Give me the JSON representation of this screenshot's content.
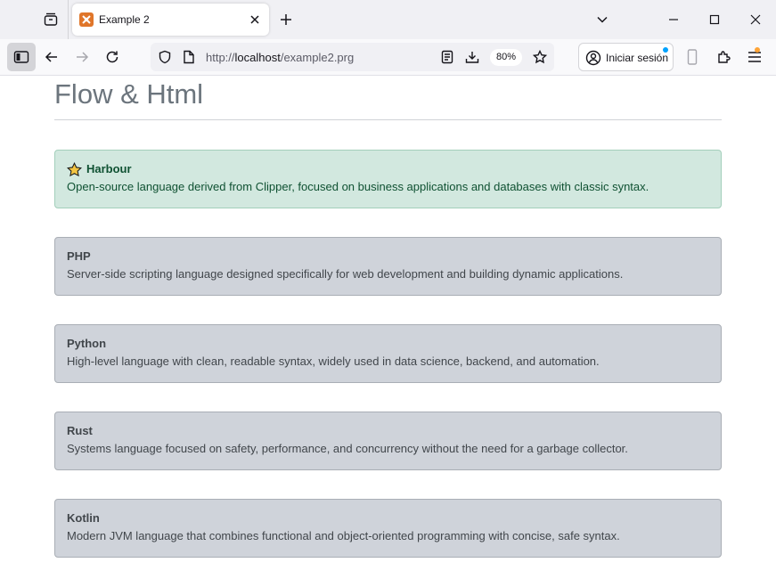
{
  "browser": {
    "tab": {
      "title": "Example 2"
    },
    "url": {
      "protocol": "http://",
      "host": "localhost",
      "path": "/example2.prg"
    },
    "zoom": "80%",
    "signin_label": "Iniciar sesión",
    "colors": {
      "accent_dot": "#00a2ff",
      "favicon": "#e0762a",
      "menu_badge": "#ffa436"
    }
  },
  "page": {
    "title": "Flow & Html",
    "cards": [
      {
        "title": "Harbour",
        "desc": "Open-source language derived from Clipper, focused on business applications and databases with classic syntax.",
        "active": true,
        "icon": "star-icon"
      },
      {
        "title": "PHP",
        "desc": "Server-side scripting language designed specifically for web development and building dynamic applications.",
        "active": false
      },
      {
        "title": "Python",
        "desc": "High-level language with clean, readable syntax, widely used in data science, backend, and automation.",
        "active": false
      },
      {
        "title": "Rust",
        "desc": "Systems language focused on safety, performance, and concurrency without the need for a garbage collector.",
        "active": false
      },
      {
        "title": "Kotlin",
        "desc": "Modern JVM language that combines functional and object-oriented programming with concise, safe syntax.",
        "active": false
      }
    ],
    "colors": {
      "active_bg": "#d2e8df",
      "active_text": "#0f5132",
      "inactive_bg": "#cfd3da",
      "title_text": "#6c757d"
    }
  }
}
